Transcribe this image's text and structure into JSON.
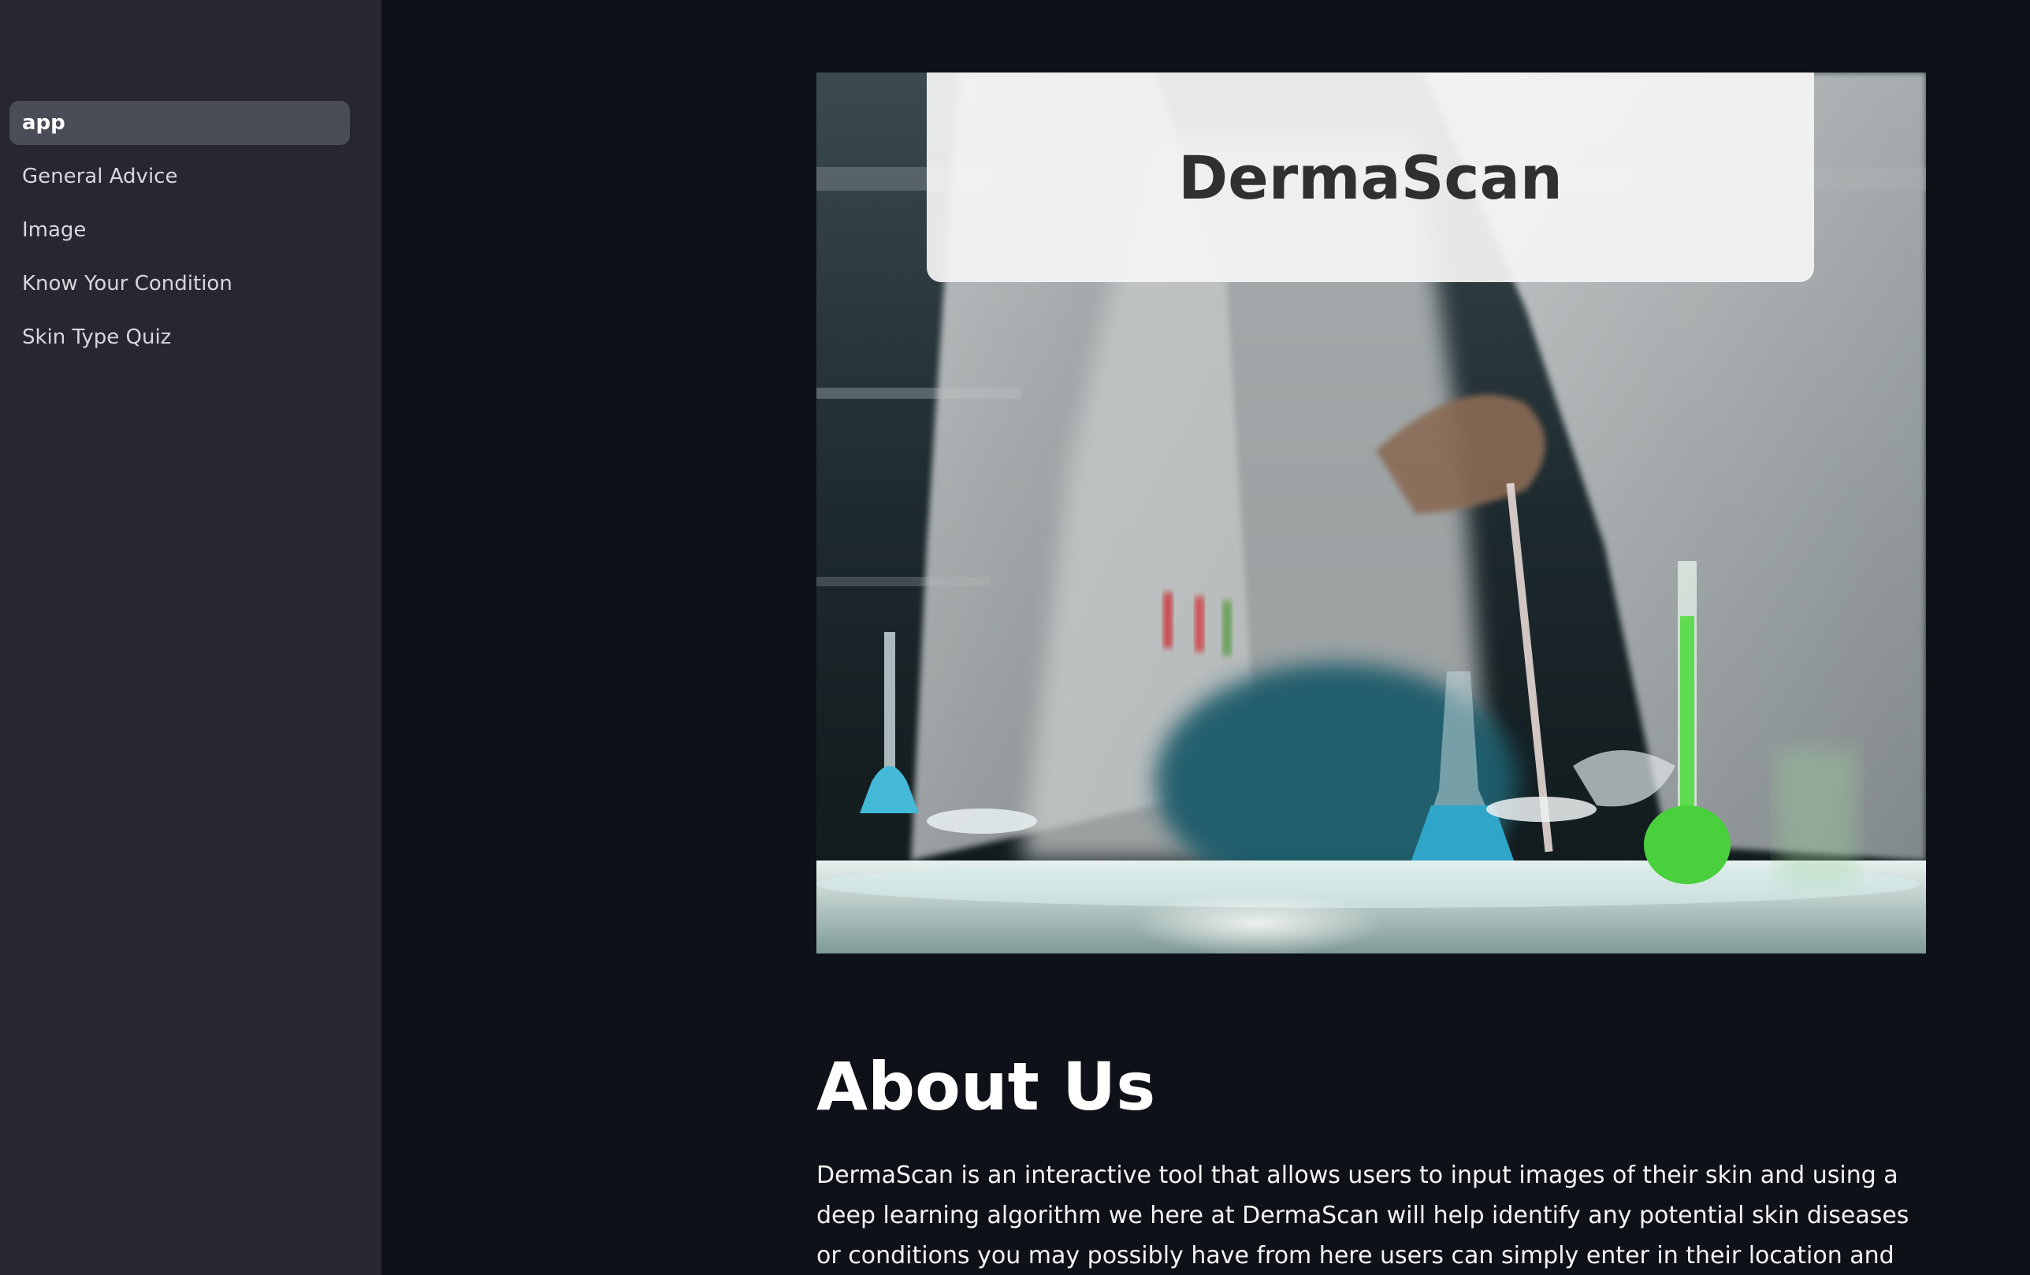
{
  "sidebar": {
    "items": [
      {
        "label": "app",
        "active": true
      },
      {
        "label": "General Advice",
        "active": false
      },
      {
        "label": "Image",
        "active": false
      },
      {
        "label": "Know Your Condition",
        "active": false
      },
      {
        "label": "Skin Type Quiz",
        "active": false
      }
    ]
  },
  "hero": {
    "title": "DermaScan"
  },
  "about": {
    "heading": "About Us",
    "text": "DermaScan is an interactive tool that allows users to input images of their skin and using a deep learning algorithm we here at DermaScan will help identify any potential skin diseases or conditions you may possibly have from here users can simply enter in their location and we will show you the specialists for"
  },
  "colors": {
    "background": "#0e1117",
    "sidebar": "#262730",
    "active_item": "#4a4c57",
    "title_card": "#f4f4f4"
  }
}
